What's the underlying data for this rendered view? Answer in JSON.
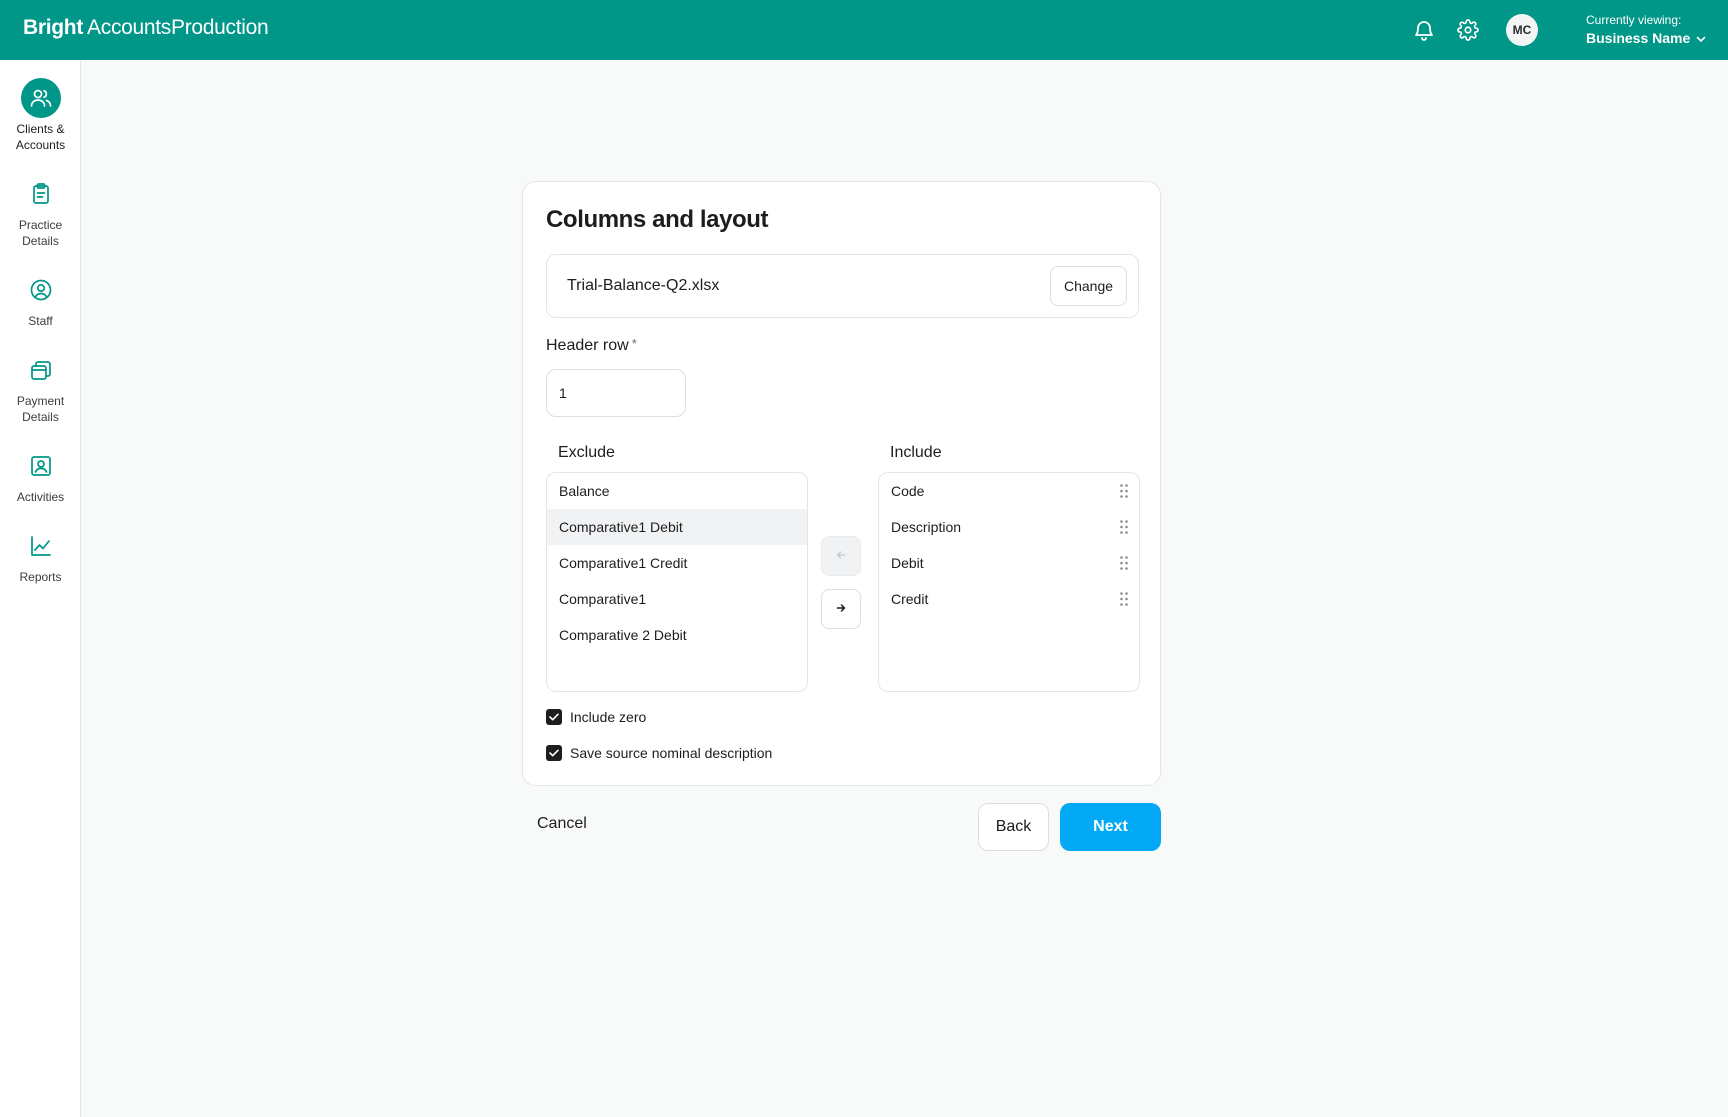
{
  "app": {
    "brand_bold": "Bright",
    "brand_rest": "AccountsProduction"
  },
  "header": {
    "avatar_initials": "MC",
    "viewing_label": "Currently viewing:",
    "business_name": "Business Name",
    "icons": [
      "bell-icon",
      "gear-icon",
      "chevron-down-icon"
    ],
    "accent_color": "#009688"
  },
  "sidebar": {
    "items": [
      {
        "label": "Clients &\nAccounts",
        "icon": "users-icon",
        "active": true
      },
      {
        "label": "Practice\nDetails",
        "icon": "clipboard-icon",
        "active": false
      },
      {
        "label": "Staff",
        "icon": "user-circle-icon",
        "active": false
      },
      {
        "label": "Payment\nDetails",
        "icon": "cards-icon",
        "active": false
      },
      {
        "label": "Activities",
        "icon": "contact-card-icon",
        "active": false
      },
      {
        "label": "Reports",
        "icon": "line-chart-icon",
        "active": false
      }
    ]
  },
  "card": {
    "title": "Columns and layout",
    "file_name": "Trial-Balance-Q2.xlsx",
    "change_label": "Change",
    "header_row_label": "Header row",
    "required_mark": "*",
    "header_row_value": "1",
    "exclude_heading": "Exclude",
    "include_heading": "Include",
    "exclude_items": [
      "Balance",
      "Comparative1 Debit",
      "Comparative1 Credit",
      "Comparative1",
      "Comparative 2 Debit"
    ],
    "exclude_selected": "Comparative1 Debit",
    "include_items": [
      "Code",
      "Description",
      "Debit",
      "Credit"
    ],
    "include_zero_label": "Include zero",
    "include_zero_checked": true,
    "save_source_label": "Save source nominal description",
    "save_source_checked": true
  },
  "footer": {
    "cancel_label": "Cancel",
    "back_label": "Back",
    "next_label": "Next",
    "next_color": "#03a9f4"
  }
}
